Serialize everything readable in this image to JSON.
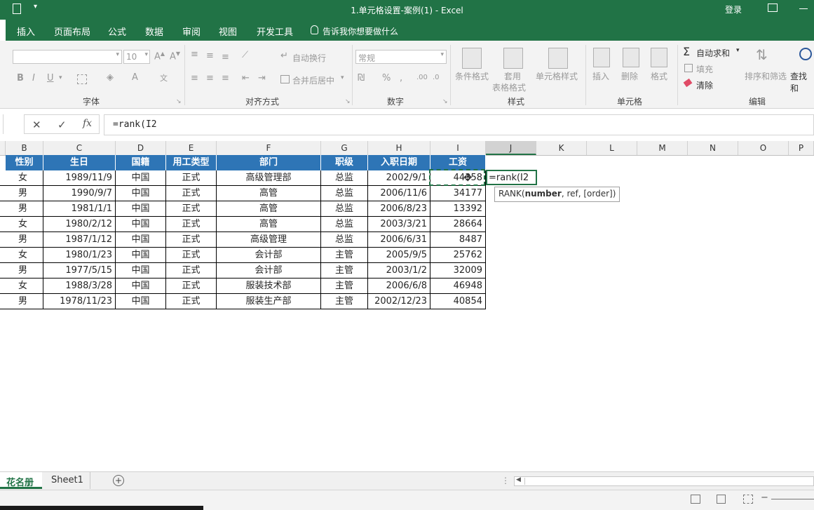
{
  "window": {
    "title": "1.单元格设置-案例(1)  -  Excel",
    "login": "登录"
  },
  "ribbon_tabs": [
    "插入",
    "页面布局",
    "公式",
    "数据",
    "审阅",
    "视图",
    "开发工具"
  ],
  "tell_me": "告诉我你想要做什么",
  "ribbon": {
    "font_size": "10",
    "wrap_text": "自动换行",
    "merge_center": "合并后居中",
    "number_format": "常规",
    "conditional_format": "条件格式",
    "format_as_table_1": "套用",
    "format_as_table_2": "表格格式",
    "cell_styles": "单元格样式",
    "insert": "插入",
    "delete": "删除",
    "format": "格式",
    "autosum": "自动求和",
    "fill": "填充",
    "clear": "清除",
    "sort_filter": "排序和筛选",
    "find_select": "查找和",
    "groups": {
      "font": "字体",
      "alignment": "对齐方式",
      "number": "数字",
      "styles": "样式",
      "cells": "单元格",
      "editing": "编辑"
    }
  },
  "formula_bar": {
    "formula": "=rank(I2"
  },
  "column_headers": [
    "B",
    "C",
    "D",
    "E",
    "F",
    "G",
    "H",
    "I",
    "J",
    "K",
    "L",
    "M",
    "N",
    "O",
    "P"
  ],
  "table": {
    "headers": [
      "性别",
      "生日",
      "国籍",
      "用工类型",
      "部门",
      "职级",
      "入职日期",
      "工资"
    ],
    "rows": [
      [
        "女",
        "1989/11/9",
        "中国",
        "正式",
        "高级管理部",
        "总监",
        "2002/9/1",
        "44358"
      ],
      [
        "男",
        "1990/9/7",
        "中国",
        "正式",
        "高管",
        "总监",
        "2006/11/6",
        "34177"
      ],
      [
        "男",
        "1981/1/1",
        "中国",
        "正式",
        "高管",
        "总监",
        "2006/8/23",
        "13392"
      ],
      [
        "女",
        "1980/2/12",
        "中国",
        "正式",
        "高管",
        "总监",
        "2003/3/21",
        "28664"
      ],
      [
        "男",
        "1987/1/12",
        "中国",
        "正式",
        "高级管理",
        "总监",
        "2006/6/31",
        "8487"
      ],
      [
        "女",
        "1980/1/23",
        "中国",
        "正式",
        "会计部",
        "主管",
        "2005/9/5",
        "25762"
      ],
      [
        "男",
        "1977/5/15",
        "中国",
        "正式",
        "会计部",
        "主管",
        "2003/1/2",
        "32009"
      ],
      [
        "女",
        "1988/3/28",
        "中国",
        "正式",
        "服装技术部",
        "主管",
        "2006/6/8",
        "46948"
      ],
      [
        "男",
        "1978/11/23",
        "中国",
        "正式",
        "服装生产部",
        "主管",
        "2002/12/23",
        "40854"
      ]
    ]
  },
  "editing_cell": {
    "text": "=rank(I2",
    "tooltip_fn": "RANK(",
    "tooltip_bold": "number",
    "tooltip_rest": ", ref, [order])"
  },
  "sheets": [
    "花名册",
    "Sheet1"
  ]
}
